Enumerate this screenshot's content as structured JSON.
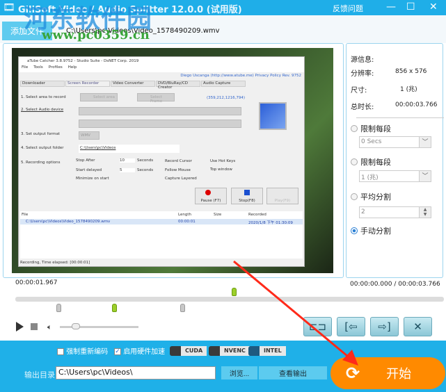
{
  "window": {
    "title": "GiliSoft Video / Audio Splitter 12.0.0 (试用版)",
    "feedback": "反馈问题",
    "minimize": "—",
    "maximize": "☐",
    "close": "✕"
  },
  "watermark": {
    "name": "河东软件园",
    "url": "www.pc0359.cn"
  },
  "toolbar": {
    "add_file": "添加文件",
    "file_path": "C:\\Users\\pc\\Videos\\Video_1578490209.wmv"
  },
  "preview": {
    "app_title": "aTube Catcher 3.8.9752 - Studio Suite - DsNET Corp. 2019",
    "menu": [
      "File",
      "Tools",
      "Profiles",
      "Help"
    ],
    "links": "Diego Uscanga (http://www.atube.me)   Privacy Policy   Rev. 9752",
    "tabs": [
      "Downloader",
      "Screen Recorder",
      "Video Converter",
      "DVD/BluRay/CD Creator",
      "Audio Capture"
    ],
    "steps": [
      "1. Select area to record",
      "2. Select Audio device",
      "3. Set output format",
      "4. Select output folder",
      "5. Recording options"
    ],
    "select_area": "Select area",
    "select_frame": "Select Frame",
    "coords": "(359,212,1216,794)",
    "format": "WMV",
    "folder": "C:\\Users\\pc\\Videos",
    "options": [
      "Stop After",
      "Start delayed",
      "Minimize on start",
      "Record Cursor",
      "Follow Mouse",
      "Capture Layered",
      "Use Hot Keys",
      "Top window"
    ],
    "sec1": "10",
    "sec2": "5",
    "seconds": "Seconds",
    "pause": "Pause (F7)",
    "stop": "Stop(F8)",
    "play": "Play(F9)",
    "list_headers": [
      "File",
      "Length",
      "Size",
      "Recorded"
    ],
    "list_row": [
      "C:\\Users\\pc\\Videos\\Video_1578490209.wmv",
      "00:00:01",
      "",
      "2020/1/8 下午 01:30:09"
    ],
    "status": "Recording, Time elapsed: [00:00:01]"
  },
  "side": {
    "source_info": "源信息:",
    "resolution_label": "分辨率:",
    "resolution": "856 x 576",
    "size_label": "尺寸:",
    "size": "1 (兆)",
    "duration_label": "总时长:",
    "duration": "00:00:03.766",
    "opt_time": "限制每段",
    "time_value": "0 Secs",
    "opt_size": "限制每段",
    "size_value": "1 (兆)",
    "opt_avg": "平均分割",
    "avg_value": "2",
    "opt_manual": "手动分割",
    "selected": "manual"
  },
  "timeline": {
    "current": "00:00:01.967",
    "range": "00:00:00.000 / 00:00:03.766",
    "playhead_fraction": 0.51,
    "markers": [
      0.1,
      0.23,
      0.39
    ],
    "volume_fraction": 0.2
  },
  "bottom": {
    "force_reencode": "强制重新编码",
    "force_checked": false,
    "hw_accel": "启用硬件加速",
    "hw_checked": true,
    "chips": [
      "CUDA",
      "NVENC",
      "INTEL"
    ],
    "output_label": "输出目录:",
    "output_path": "C:\\Users\\pc\\Videos\\",
    "browse": "浏览...",
    "view_output": "查看输出",
    "start": "开始"
  },
  "colors": {
    "accent": "#1faee8",
    "start": "#ff8a00",
    "arrow": "#ff2a1a"
  }
}
